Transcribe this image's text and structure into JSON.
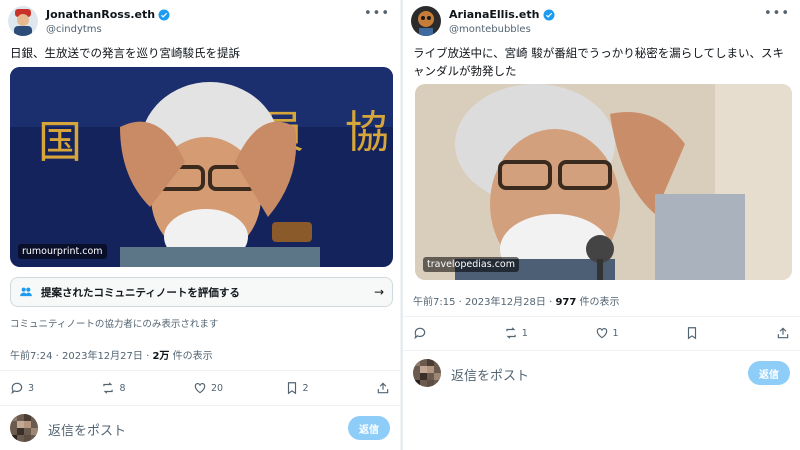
{
  "left": {
    "display_name": "JonathanRoss.eth",
    "handle": "@cindytms",
    "text": "日銀、生放送での発言を巡り宮崎駿氏を提訴",
    "image_watermark": "rumourprint.com",
    "community_note_label": "提案されたコミュニティノートを評価する",
    "community_note_visibility": "コミュニティノートの協力者にのみ表示されます",
    "time": "午前7:24 · 2023年12月27日 · ",
    "views_count": "2万",
    "views_suffix": " 件の表示",
    "counts": {
      "replies": "3",
      "reposts": "8",
      "likes": "20",
      "bookmarks": "2"
    },
    "reply_placeholder": "返信をポスト",
    "reply_button": "返信"
  },
  "right": {
    "display_name": "ArianaEllis.eth",
    "handle": "@montebubbles",
    "text": "ライブ放送中に、宮崎 駿が番組でうっかり秘密を漏らしてしまい、スキャンダルが勃発した",
    "image_watermark": "travelopedias.com",
    "time": "午前7:15 · 2023年12月28日 · ",
    "views_count": "977",
    "views_suffix": " 件の表示",
    "counts": {
      "replies": "",
      "reposts": "1",
      "likes": "1",
      "bookmarks": ""
    },
    "reply_placeholder": "返信をポスト",
    "reply_button": "返信"
  },
  "colors": {
    "verified": "#1d9bf0",
    "reply_button": "#8ecdf8",
    "muted": "#536471"
  },
  "icons": [
    "verified-badge-icon",
    "more-icon",
    "community-note-icon",
    "arrow-right-icon",
    "reply-icon",
    "repost-icon",
    "like-icon",
    "bookmark-icon",
    "share-icon"
  ]
}
